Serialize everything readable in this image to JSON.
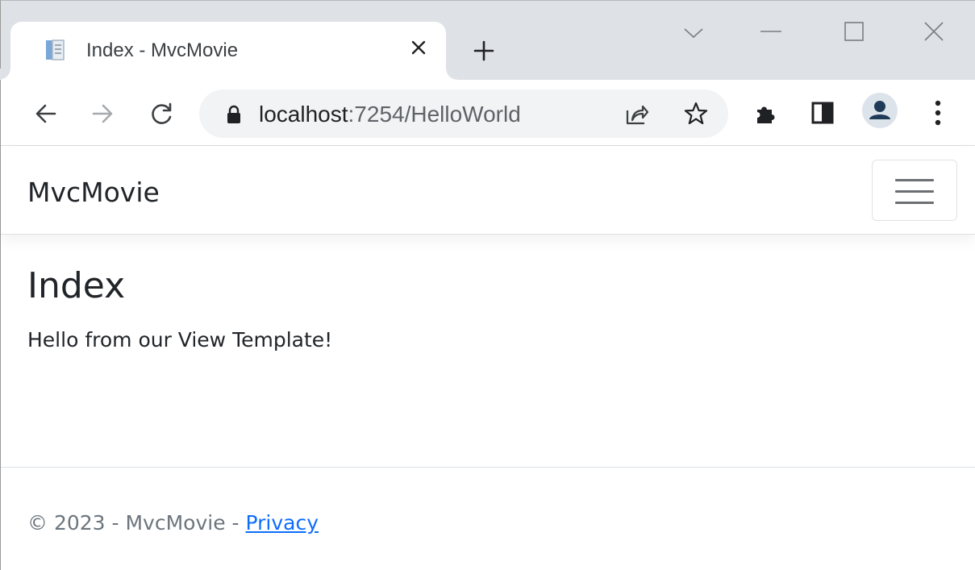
{
  "browser": {
    "tab": {
      "title": "Index - MvcMovie",
      "favicon": "page-document-icon"
    },
    "newtab_icon": "plus-icon",
    "address": {
      "host": "localhost",
      "path": ":7254/HelloWorld"
    },
    "icons": {
      "back": "arrow-left-icon",
      "forward": "arrow-right-icon",
      "reload": "reload-icon",
      "lock": "lock-icon",
      "share": "share-icon",
      "bookmark": "star-icon",
      "extensions": "puzzle-icon",
      "side_panel": "side-panel-icon",
      "profile": "person-icon",
      "menu": "vertical-dots-icon"
    },
    "window_controls": [
      "tab-search-icon",
      "minimize-icon",
      "maximize-icon",
      "close-icon"
    ]
  },
  "navbar": {
    "brand": "MvcMovie",
    "toggler_icon": "hamburger-menu-icon"
  },
  "main": {
    "title": "Index",
    "text": "Hello from our View Template!"
  },
  "footer": {
    "prefix": "© 2023 - MvcMovie - ",
    "privacy_link": "Privacy"
  },
  "colors": {
    "tabstrip": "#dee1e6",
    "omnibox": "#f1f3f4",
    "link": "#0d6efd",
    "text": "#212529",
    "muted": "#6c757d"
  }
}
